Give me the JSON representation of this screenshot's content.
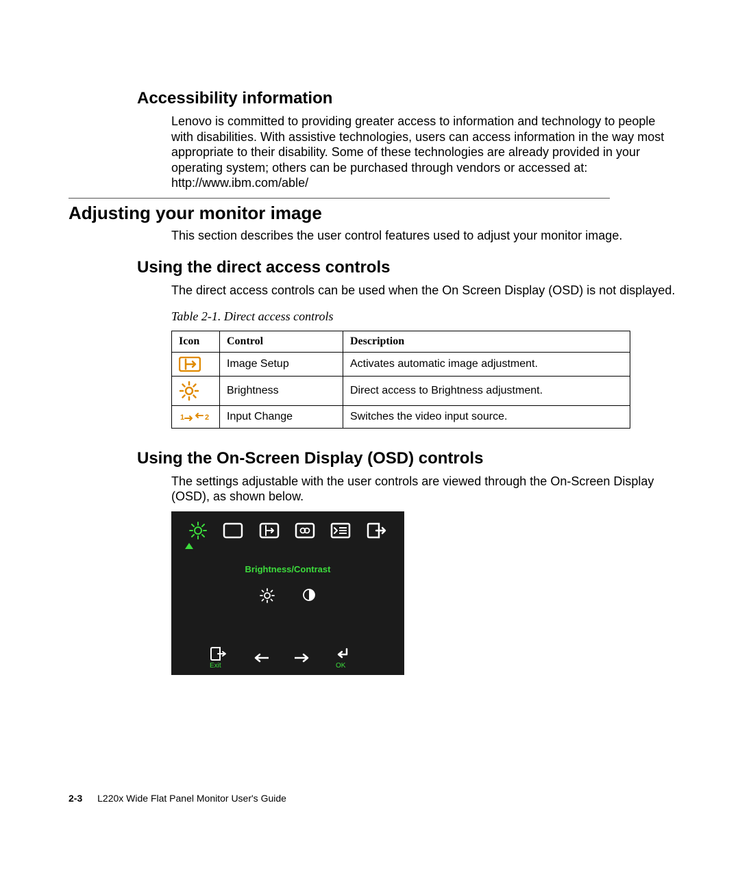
{
  "sections": {
    "accessibility": {
      "heading": "Accessibility information",
      "body": "Lenovo is committed to providing greater access to information and technology to people with disabilities. With assistive technologies, users can access information in the way most appropriate to their disability. Some of these technologies are already provided in your operating system; others can be purchased through vendors or accessed at: http://www.ibm.com/able/"
    },
    "adjusting": {
      "heading": "Adjusting your monitor image",
      "body": "This section describes the user control features used to adjust your monitor image."
    },
    "direct": {
      "heading": "Using the direct access controls",
      "body": "The direct access controls can be used when the On Screen Display (OSD) is not displayed."
    },
    "osd": {
      "heading": "Using the On-Screen Display (OSD) controls",
      "body": "The settings adjustable with the user controls are viewed through the On-Screen Display (OSD), as shown below."
    }
  },
  "table": {
    "caption": "Table 2-1. Direct access controls",
    "headers": {
      "icon": "Icon",
      "control": "Control",
      "description": "Description"
    },
    "rows": [
      {
        "icon": "image-setup-icon",
        "control": "Image Setup",
        "description": "Activates automatic image adjustment."
      },
      {
        "icon": "brightness-icon",
        "control": "Brightness",
        "description": "Direct access to Brightness adjustment."
      },
      {
        "icon": "input-change-icon",
        "control": "Input Change",
        "description": "Switches the video input source."
      }
    ]
  },
  "osd_panel": {
    "title": "Brightness/Contrast",
    "exit": "Exit",
    "ok": "OK",
    "top_icons": [
      "brightness-contrast-icon",
      "image-position-icon",
      "image-setup-icon",
      "image-properties-icon",
      "options-icon",
      "exit-icon"
    ],
    "mid_icons": [
      "brightness-sub-icon",
      "contrast-sub-icon"
    ],
    "nav": [
      "exit-nav-icon",
      "left-arrow-icon",
      "right-arrow-icon",
      "enter-icon"
    ]
  },
  "footer": {
    "page": "2-3",
    "title": "L220x Wide Flat Panel Monitor User's Guide"
  }
}
